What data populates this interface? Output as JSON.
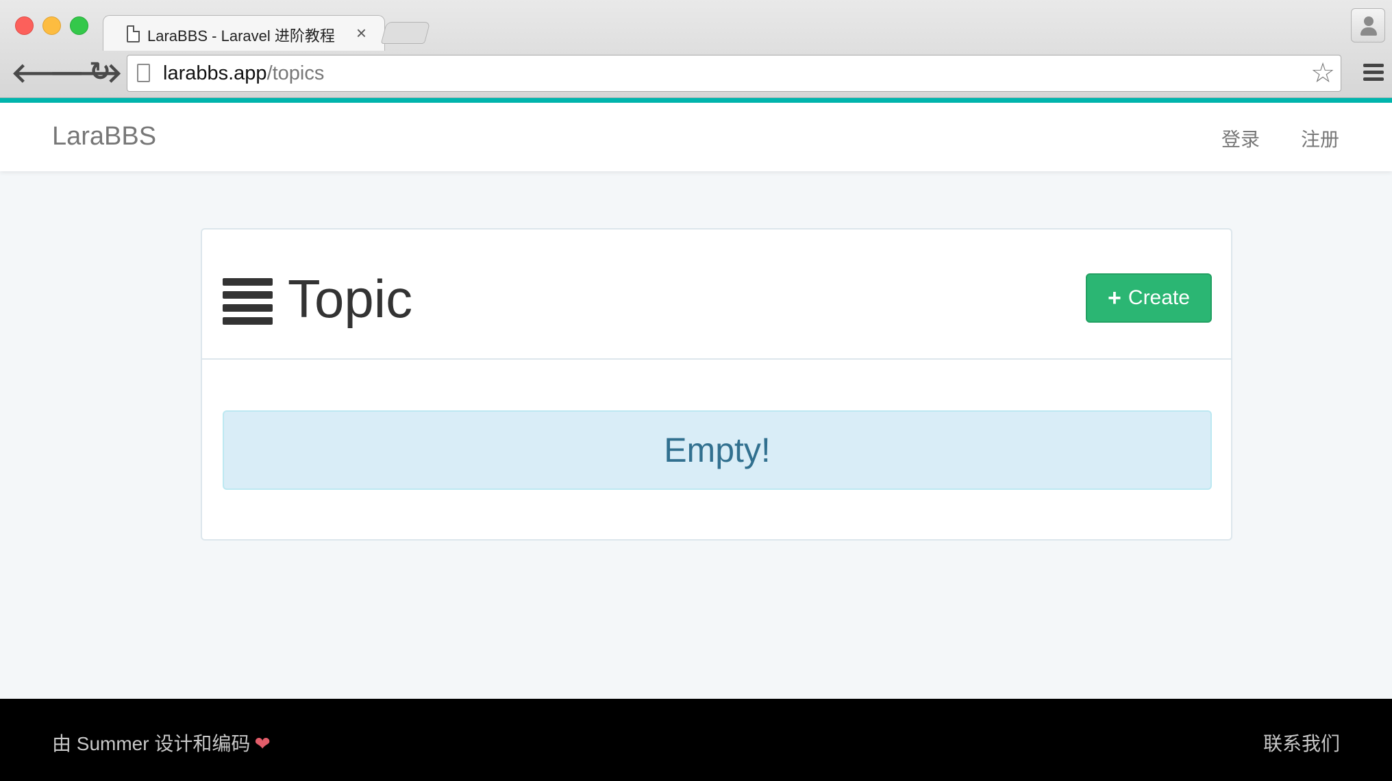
{
  "browser": {
    "tab_title": "LaraBBS - Laravel 进阶教程",
    "tab_close": "×",
    "url_host": "larabbs.app",
    "url_path": "/topics",
    "icons": {
      "back": "arrow-left-icon",
      "forward": "arrow-right-icon",
      "reload": "reload-icon",
      "bookmark": "star-icon",
      "menu": "hamburger-menu-icon",
      "profile": "profile-icon",
      "page": "document-icon"
    },
    "accent_color": "#00b5ad"
  },
  "navbar": {
    "brand": "LaraBBS",
    "login": "登录",
    "register": "注册"
  },
  "topics_panel": {
    "title": "Topic",
    "title_icon": "list-icon",
    "create_label": "Create",
    "create_icon": "plus-icon",
    "create_color": "#2bb673",
    "empty_message": "Empty!",
    "empty_bg_color": "#d9edf7"
  },
  "footer": {
    "credit": "由 Summer 设计和编码",
    "heart": "❤",
    "contact": "联系我们"
  }
}
